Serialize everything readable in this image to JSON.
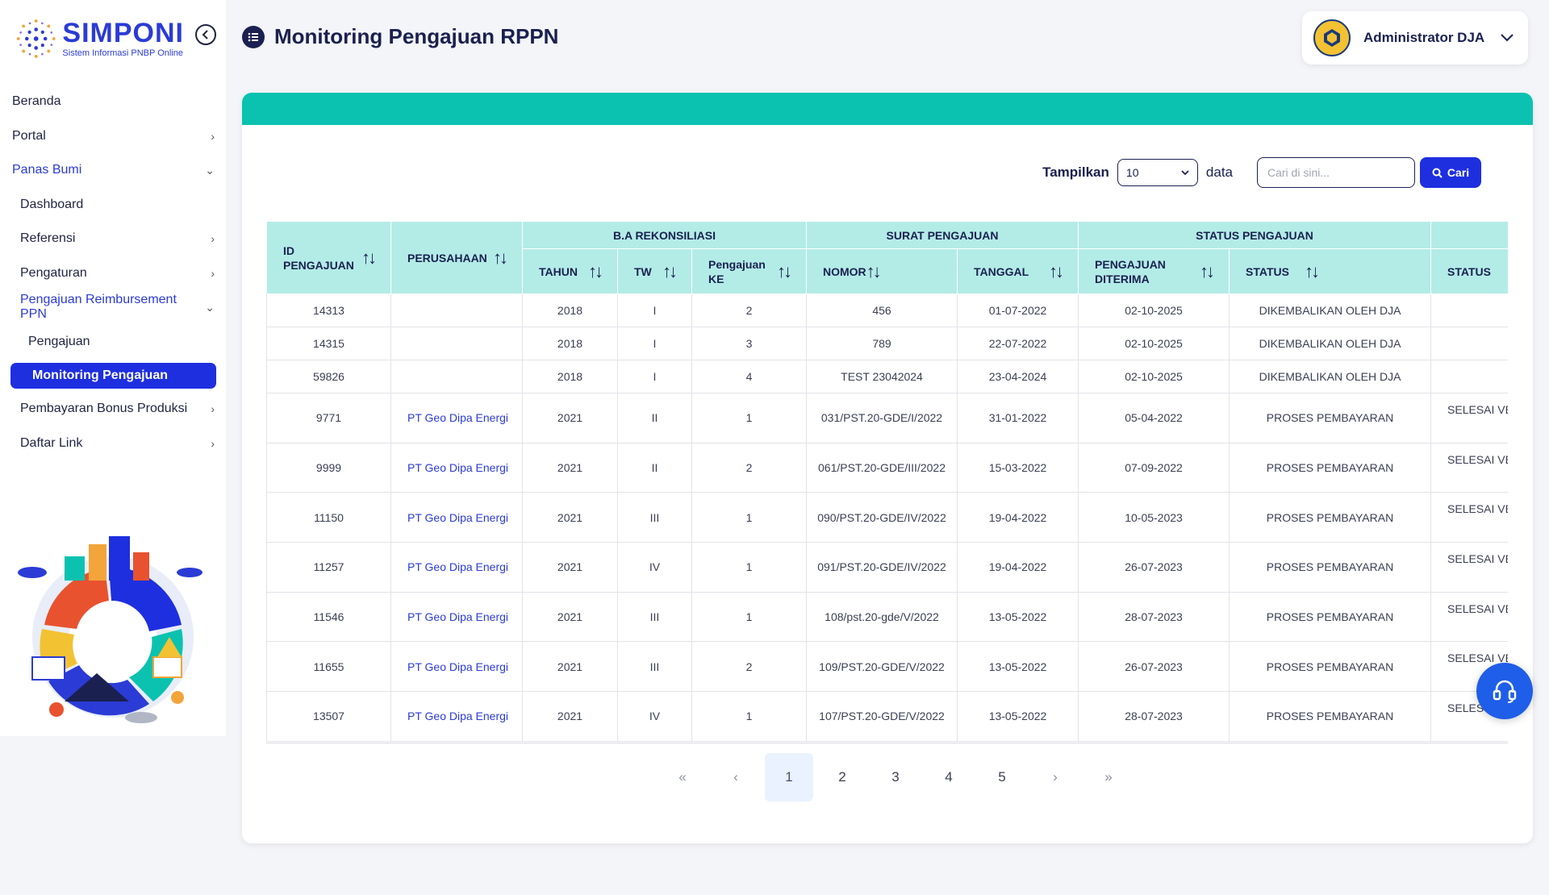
{
  "app": {
    "logo_title": "SIMPONI",
    "logo_subtitle": "Sistem Informasi PNBP Online"
  },
  "sidebar": {
    "items": [
      {
        "label": "Beranda"
      },
      {
        "label": "Portal"
      },
      {
        "label": "Panas Bumi"
      },
      {
        "label": "Dashboard"
      },
      {
        "label": "Referensi"
      },
      {
        "label": "Pengaturan"
      },
      {
        "label": "Pengajuan Reimbursement PPN"
      },
      {
        "label": "Pengajuan"
      },
      {
        "label": "Monitoring Pengajuan"
      },
      {
        "label": "Pembayaran Bonus Produksi"
      },
      {
        "label": "Daftar Link"
      }
    ]
  },
  "header": {
    "title": "Monitoring Pengajuan RPPN",
    "user": "Administrator DJA"
  },
  "controls": {
    "show_label": "Tampilkan",
    "page_size": "10",
    "data_label": "data",
    "search_placeholder": "Cari di sini...",
    "search_button": "Cari"
  },
  "table": {
    "groups": {
      "ba": "B.A REKONSILIASI",
      "surat": "SURAT PENGAJUAN",
      "status": "STATUS PENGAJUAN"
    },
    "columns": {
      "id": "ID PENGAJUAN",
      "perusahaan": "PERUSAHAAN",
      "tahun": "TAHUN",
      "tw": "TW",
      "ke": "Pengajuan KE",
      "nomor": "NOMOR",
      "tanggal": "TANGGAL",
      "diterima": "PENGAJUAN DITERIMA",
      "status": "STATUS",
      "status2": "STATUS"
    },
    "rows": [
      {
        "id": "14313",
        "perusahaan": "",
        "tahun": "2018",
        "tw": "I",
        "ke": "2",
        "nomor": "456",
        "tanggal": "01-07-2022",
        "diterima": "02-10-2025",
        "status": "DIKEMBALIKAN OLEH DJA",
        "status2": ""
      },
      {
        "id": "14315",
        "perusahaan": "",
        "tahun": "2018",
        "tw": "I",
        "ke": "3",
        "nomor": "789",
        "tanggal": "22-07-2022",
        "diterima": "02-10-2025",
        "status": "DIKEMBALIKAN OLEH DJA",
        "status2": ""
      },
      {
        "id": "59826",
        "perusahaan": "",
        "tahun": "2018",
        "tw": "I",
        "ke": "4",
        "nomor": "TEST 23042024",
        "tanggal": "23-04-2024",
        "diterima": "02-10-2025",
        "status": "DIKEMBALIKAN OLEH DJA",
        "status2": ""
      },
      {
        "id": "9771",
        "perusahaan": "PT Geo Dipa Energi",
        "tahun": "2021",
        "tw": "II",
        "ke": "1",
        "nomor": "031/PST.20-GDE/I/2022",
        "tanggal": "31-01-2022",
        "diterima": "05-04-2022",
        "status": "PROSES PEMBAYARAN",
        "status2": "SELESAI VE"
      },
      {
        "id": "9999",
        "perusahaan": "PT Geo Dipa Energi",
        "tahun": "2021",
        "tw": "II",
        "ke": "2",
        "nomor": "061/PST.20-GDE/III/2022",
        "tanggal": "15-03-2022",
        "diterima": "07-09-2022",
        "status": "PROSES PEMBAYARAN",
        "status2": "SELESAI VE"
      },
      {
        "id": "11150",
        "perusahaan": "PT Geo Dipa Energi",
        "tahun": "2021",
        "tw": "III",
        "ke": "1",
        "nomor": "090/PST.20-GDE/IV/2022",
        "tanggal": "19-04-2022",
        "diterima": "10-05-2023",
        "status": "PROSES PEMBAYARAN",
        "status2": "SELESAI VE"
      },
      {
        "id": "11257",
        "perusahaan": "PT Geo Dipa Energi",
        "tahun": "2021",
        "tw": "IV",
        "ke": "1",
        "nomor": "091/PST.20-GDE/IV/2022",
        "tanggal": "19-04-2022",
        "diterima": "26-07-2023",
        "status": "PROSES PEMBAYARAN",
        "status2": "SELESAI VE"
      },
      {
        "id": "11546",
        "perusahaan": "PT Geo Dipa Energi",
        "tahun": "2021",
        "tw": "III",
        "ke": "1",
        "nomor": "108/pst.20-gde/V/2022",
        "tanggal": "13-05-2022",
        "diterima": "28-07-2023",
        "status": "PROSES PEMBAYARAN",
        "status2": "SELESAI VE"
      },
      {
        "id": "11655",
        "perusahaan": "PT Geo Dipa Energi",
        "tahun": "2021",
        "tw": "III",
        "ke": "2",
        "nomor": "109/PST.20-GDE/V/2022",
        "tanggal": "13-05-2022",
        "diterima": "26-07-2023",
        "status": "PROSES PEMBAYARAN",
        "status2": "SELESAI VE"
      },
      {
        "id": "13507",
        "perusahaan": "PT Geo Dipa Energi",
        "tahun": "2021",
        "tw": "IV",
        "ke": "1",
        "nomor": "107/PST.20-GDE/V/2022",
        "tanggal": "13-05-2022",
        "diterima": "28-07-2023",
        "status": "PROSES PEMBAYARAN",
        "status2": "SELES"
      }
    ]
  },
  "pagination": {
    "first": "«",
    "prev": "‹",
    "pages": [
      "1",
      "2",
      "3",
      "4",
      "5"
    ],
    "next": "›",
    "last": "»",
    "current": "1"
  },
  "colors": {
    "primary": "#1e2fe0",
    "accent": "#0bc2b0",
    "header_bg": "#b3ece7"
  }
}
